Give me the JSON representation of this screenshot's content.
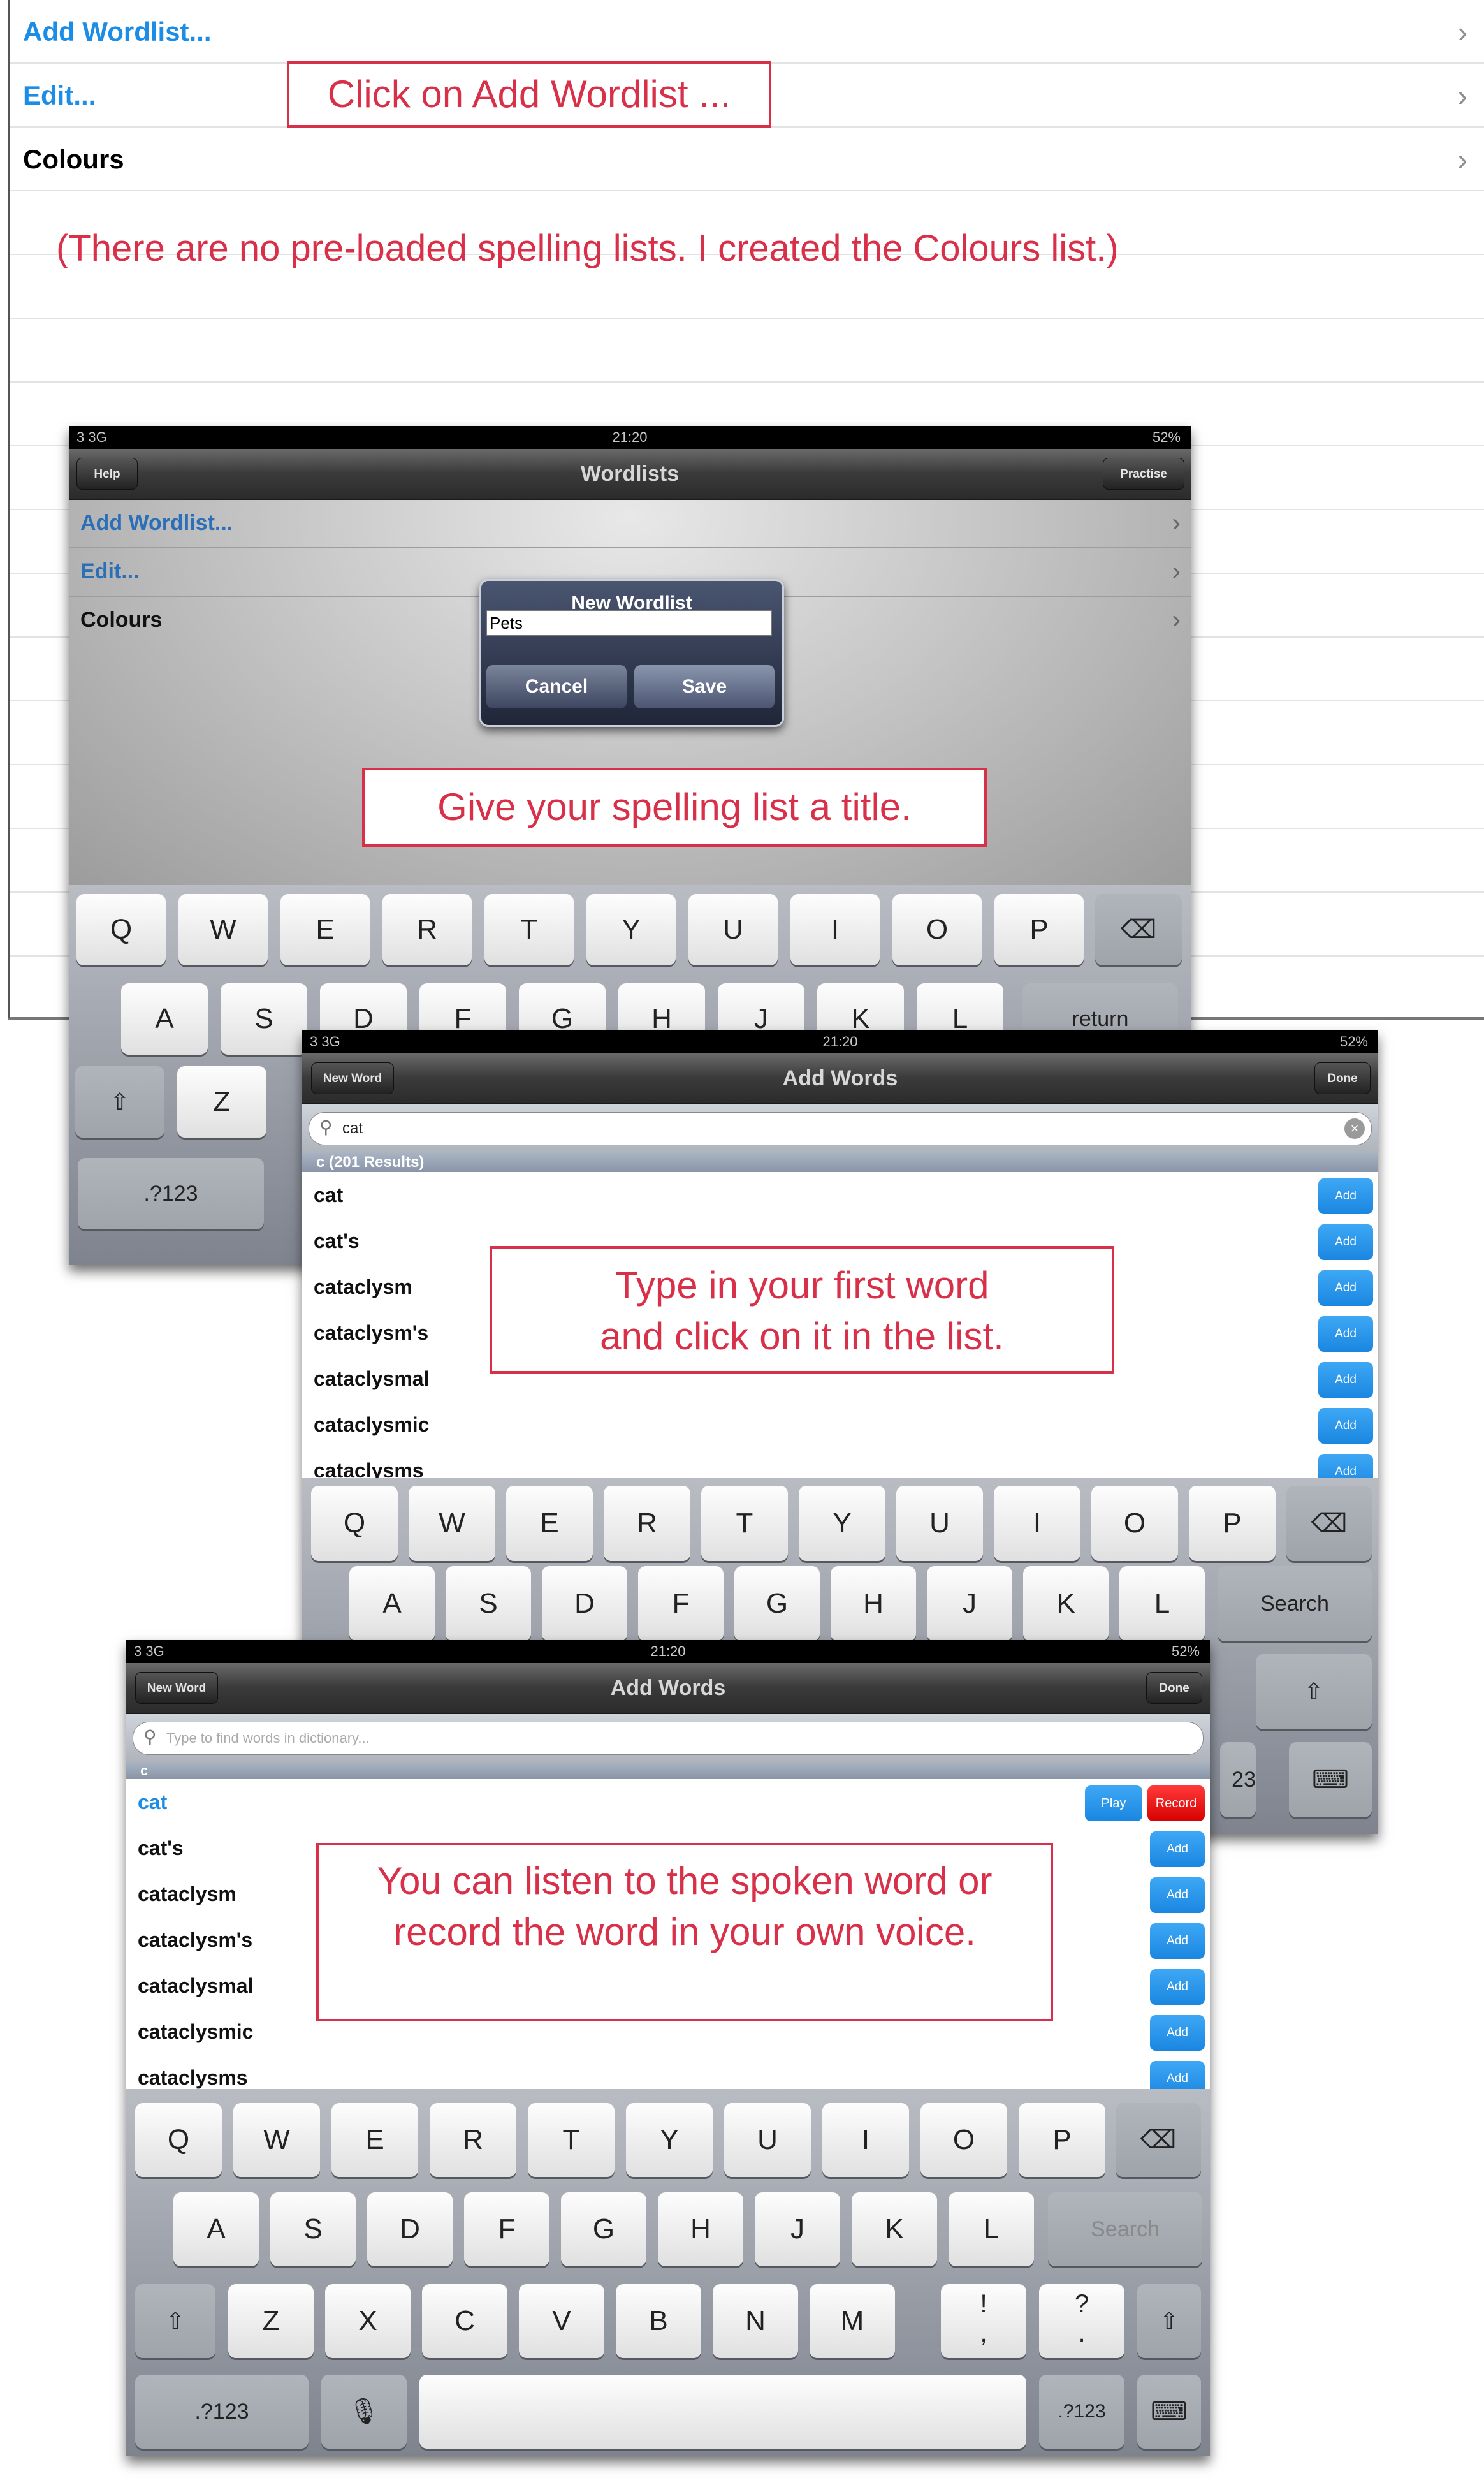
{
  "background": {
    "rows": [
      {
        "label": "Add Wordlist...",
        "color": "#1b8de6"
      },
      {
        "label": "Edit...",
        "color": "#1b8de6"
      },
      {
        "label": "Colours",
        "color": "#000000"
      }
    ],
    "callout_add": "Click on Add Wordlist ...",
    "note": "(There are no pre-loaded spelling lists. I created the Colours list.)"
  },
  "screen1": {
    "status": {
      "carrier": "3  3G",
      "time": "21:20",
      "battery": "52%"
    },
    "nav": {
      "left_btn": "Help",
      "title": "Wordlists",
      "right_btn": "Practise"
    },
    "rows": [
      "Add Wordlist...",
      "Edit...",
      "Colours"
    ],
    "dialog": {
      "title": "New Wordlist",
      "input_value": "Pets",
      "cancel": "Cancel",
      "save": "Save"
    },
    "callout": "Give your spelling list a title.",
    "keys_row1": [
      "Q",
      "W",
      "E",
      "R",
      "T",
      "Y",
      "U",
      "I",
      "O",
      "P"
    ],
    "keys_row2": [
      "A",
      "S",
      "D",
      "F",
      "G",
      "H",
      "J",
      "K",
      "L"
    ],
    "return_label": "return",
    "keys_row3": [
      "Z"
    ],
    "numkey": ".?123"
  },
  "screen2": {
    "status": {
      "carrier": "3  3G",
      "time": "21:20",
      "battery": "52%"
    },
    "nav": {
      "left_btn": "New Word",
      "title": "Add Words",
      "right_btn": "Done"
    },
    "search_value": "cat",
    "section": "c (201 Results)",
    "words": [
      "cat",
      "cat's",
      "cataclysm",
      "cataclysm's",
      "cataclysmal",
      "cataclysmic",
      "cataclysms"
    ],
    "add_label": "Add",
    "callout_line1": "Type in your first word",
    "callout_line2": "and click on it in the list.",
    "keys_row1": [
      "Q",
      "W",
      "E",
      "R",
      "T",
      "Y",
      "U",
      "I",
      "O",
      "P"
    ],
    "keys_row2": [
      "A",
      "S",
      "D",
      "F",
      "G",
      "H",
      "J",
      "K",
      "L"
    ],
    "search_key": "Search",
    "numkey_partial": "23"
  },
  "screen3": {
    "status": {
      "carrier": "3  3G",
      "time": "21:20",
      "battery": "52%"
    },
    "nav": {
      "left_btn": "New Word",
      "title": "Add Words",
      "right_btn": "Done"
    },
    "search_placeholder": "Type to find words in dictionary...",
    "section": "c",
    "selected_word": "cat",
    "play_label": "Play",
    "record_label": "Record",
    "words": [
      "cat's",
      "cataclysm",
      "cataclysm's",
      "cataclysmal",
      "cataclysmic",
      "cataclysms"
    ],
    "add_label": "Add",
    "callout_line1": "You can listen to the spoken word or",
    "callout_line2": "record the word in your own voice.",
    "keys_row1": [
      "Q",
      "W",
      "E",
      "R",
      "T",
      "Y",
      "U",
      "I",
      "O",
      "P"
    ],
    "keys_row2": [
      "A",
      "S",
      "D",
      "F",
      "G",
      "H",
      "J",
      "K",
      "L"
    ],
    "search_key": "Search",
    "keys_row3": [
      "Z",
      "X",
      "C",
      "V",
      "B",
      "N",
      "M"
    ],
    "punct1": "!\n,",
    "punct2": "?\n.",
    "numkey": ".?123"
  },
  "colors": {
    "callout": "#d9304a",
    "link": "#1b8de6",
    "add_button": "#1a86e0",
    "record_button": "#e81010"
  }
}
